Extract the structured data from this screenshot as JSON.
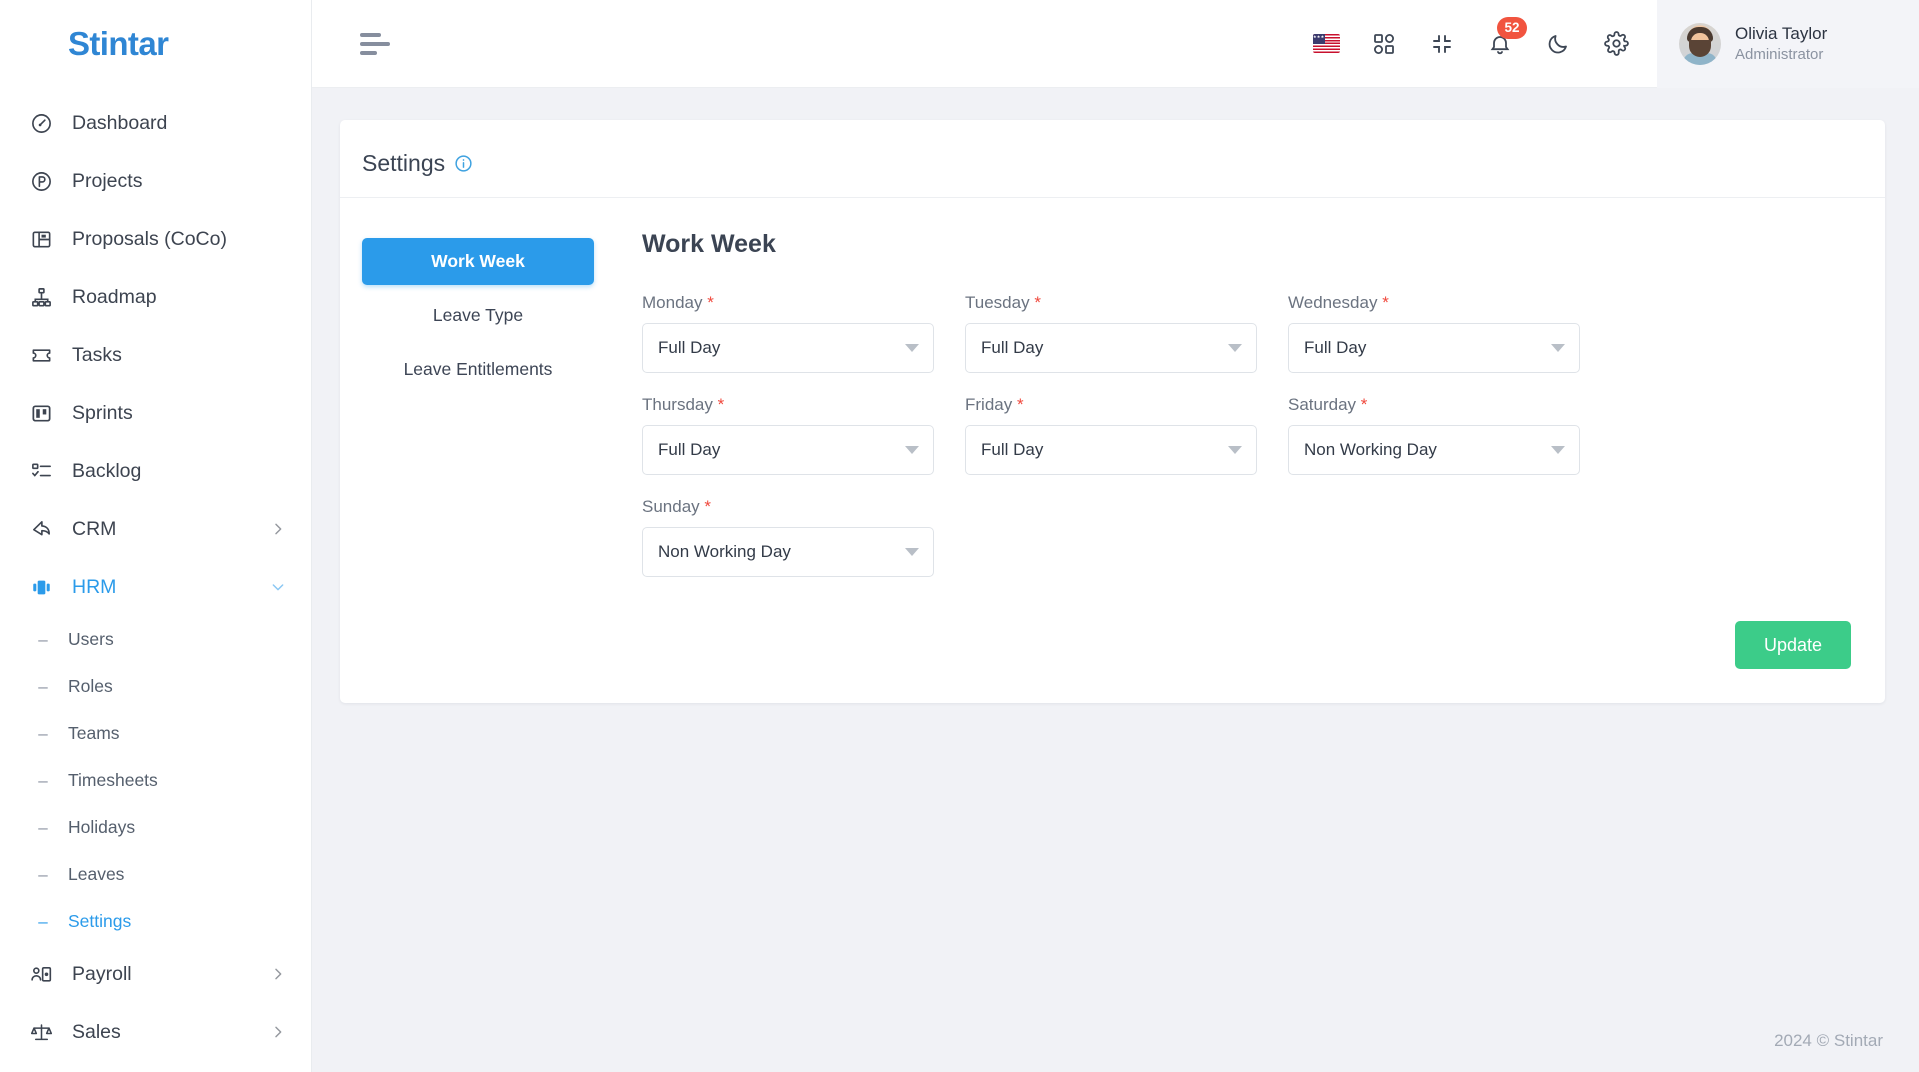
{
  "brand": {
    "name": "Stintar",
    "color": "#2f86d4"
  },
  "sidebar": {
    "items": [
      {
        "label": "Dashboard",
        "icon": "gauge-icon",
        "active": false,
        "expandable": false
      },
      {
        "label": "Projects",
        "icon": "projects-icon",
        "active": false,
        "expandable": false
      },
      {
        "label": "Proposals (CoCo)",
        "icon": "proposals-icon",
        "active": false,
        "expandable": false
      },
      {
        "label": "Roadmap",
        "icon": "roadmap-icon",
        "active": false,
        "expandable": false
      },
      {
        "label": "Tasks",
        "icon": "tasks-icon",
        "active": false,
        "expandable": false
      },
      {
        "label": "Sprints",
        "icon": "sprints-icon",
        "active": false,
        "expandable": false
      },
      {
        "label": "Backlog",
        "icon": "backlog-icon",
        "active": false,
        "expandable": false
      },
      {
        "label": "CRM",
        "icon": "crm-icon",
        "active": false,
        "expandable": true
      },
      {
        "label": "HRM",
        "icon": "hrm-icon",
        "active": true,
        "expandable": true
      }
    ],
    "hrm_children": [
      {
        "label": "Users",
        "active": false
      },
      {
        "label": "Roles",
        "active": false
      },
      {
        "label": "Teams",
        "active": false
      },
      {
        "label": "Timesheets",
        "active": false
      },
      {
        "label": "Holidays",
        "active": false
      },
      {
        "label": "Leaves",
        "active": false
      },
      {
        "label": "Settings",
        "active": true
      }
    ],
    "items_bottom": [
      {
        "label": "Payroll",
        "icon": "payroll-icon",
        "active": false,
        "expandable": true
      },
      {
        "label": "Sales",
        "icon": "sales-icon",
        "active": false,
        "expandable": true
      }
    ]
  },
  "topbar": {
    "menu_toggle": "hamburger-icon",
    "icons": [
      {
        "name": "language-flag-us"
      },
      {
        "name": "apps-grid-icon"
      },
      {
        "name": "fullscreen-exit-icon"
      },
      {
        "name": "notifications-bell-icon",
        "badge": "52"
      },
      {
        "name": "dark-mode-moon-icon"
      },
      {
        "name": "settings-gear-icon"
      }
    ],
    "notification_count": "52",
    "user": {
      "name": "Olivia Taylor",
      "role": "Administrator"
    }
  },
  "page": {
    "title": "Settings",
    "info_icon": "info-circle-icon",
    "tabs": [
      {
        "label": "Work Week",
        "active": true
      },
      {
        "label": "Leave Type",
        "active": false
      },
      {
        "label": "Leave Entitlements",
        "active": false
      }
    ],
    "panel_title": "Work Week",
    "fields": [
      {
        "label": "Monday",
        "required": "*",
        "value": "Full Day"
      },
      {
        "label": "Tuesday",
        "required": "*",
        "value": "Full Day"
      },
      {
        "label": "Wednesday",
        "required": "*",
        "value": "Full Day"
      },
      {
        "label": "Thursday",
        "required": "*",
        "value": "Full Day"
      },
      {
        "label": "Friday",
        "required": "*",
        "value": "Full Day"
      },
      {
        "label": "Saturday",
        "required": "*",
        "value": "Non Working Day"
      },
      {
        "label": "Sunday",
        "required": "*",
        "value": "Non Working Day"
      }
    ],
    "update_button": "Update"
  },
  "footer": {
    "text": "2024 © Stintar"
  }
}
